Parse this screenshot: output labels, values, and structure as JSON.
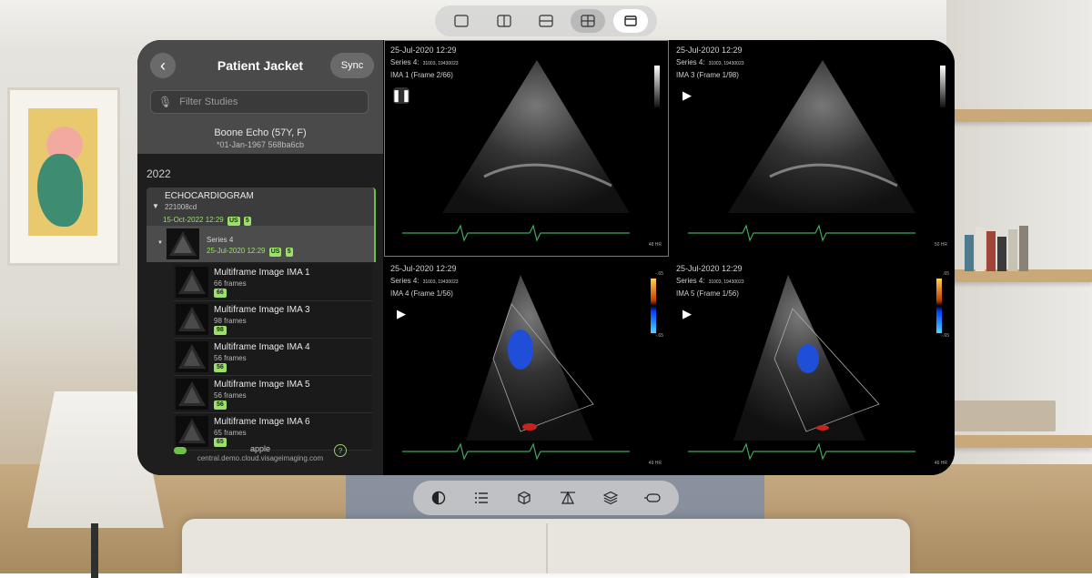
{
  "layout_bar": {
    "buttons": [
      {
        "icon": "single-view-icon"
      },
      {
        "icon": "split-vertical-icon"
      },
      {
        "icon": "split-horizontal-icon"
      },
      {
        "icon": "grid-2x2-icon",
        "active": true
      },
      {
        "icon": "window-icon",
        "highlighted": true
      }
    ]
  },
  "panel": {
    "title": "Patient Jacket",
    "sync_label": "Sync",
    "filter_placeholder": "Filter Studies",
    "patient_name": "Boone Echo (57Y, F)",
    "patient_sub": "*01-Jan-1967  568ba6cb",
    "year": "2022",
    "study": {
      "name": "ECHOCARDIOGRAM",
      "id": "221008cd",
      "date": "15-Oct-2022 12:29",
      "modality": "US",
      "count": "5"
    },
    "series": {
      "name": "Series 4",
      "date": "25-Jul-2020 12:29",
      "modality": "US",
      "count": "5"
    },
    "images": [
      {
        "name": "Multiframe Image IMA 1",
        "frames": "66 frames",
        "badge": "66"
      },
      {
        "name": "Multiframe Image IMA 3",
        "frames": "98 frames",
        "badge": "98"
      },
      {
        "name": "Multiframe Image IMA 4",
        "frames": "56 frames",
        "badge": "56"
      },
      {
        "name": "Multiframe Image IMA 5",
        "frames": "56 frames",
        "badge": "56"
      },
      {
        "name": "Multiframe Image IMA 6",
        "frames": "65 frames",
        "badge": "65"
      }
    ],
    "footer_user": "apple",
    "footer_url": "central.demo.cloud.visageimaging.com",
    "help_label": "?"
  },
  "viewports": [
    {
      "date": "25-Jul-2020 12:29",
      "series": "Series 4:",
      "series_tiny": "31003, 19430023",
      "ima": "IMA 1 (Frame 2/66)",
      "state": "pause",
      "hr": "48 HR",
      "doppler": false
    },
    {
      "date": "25-Jul-2020 12:29",
      "series": "Series 4:",
      "series_tiny": "31003, 19430023",
      "ima": "IMA 3 (Frame 1/98)",
      "state": "play",
      "hr": "50 HR",
      "doppler": false
    },
    {
      "date": "25-Jul-2020 12:29",
      "series": "Series 4:",
      "series_tiny": "31003, 19430023",
      "ima": "IMA 4 (Frame 1/56)",
      "state": "play",
      "hr": "49 HR",
      "doppler": true,
      "scale_top": "-.65",
      "scale_bottom": "-.65"
    },
    {
      "date": "25-Jul-2020 12:29",
      "series": "Series 4:",
      "series_tiny": "31003, 19430023",
      "ima": "IMA 5 (Frame 1/56)",
      "state": "play",
      "hr": "46 HR",
      "doppler": true,
      "scale_top": ".65",
      "scale_bottom": "-.65"
    }
  ],
  "toolbar": {
    "buttons": [
      {
        "icon": "contrast-icon"
      },
      {
        "icon": "list-icon"
      },
      {
        "icon": "cube-icon"
      },
      {
        "icon": "measure-icon"
      },
      {
        "icon": "layers-icon"
      },
      {
        "icon": "headset-icon"
      }
    ]
  },
  "colors": {
    "accent_green": "#9be06a",
    "panel_bg": "#1e1e1e",
    "panel_head": "#4a4a4a"
  }
}
